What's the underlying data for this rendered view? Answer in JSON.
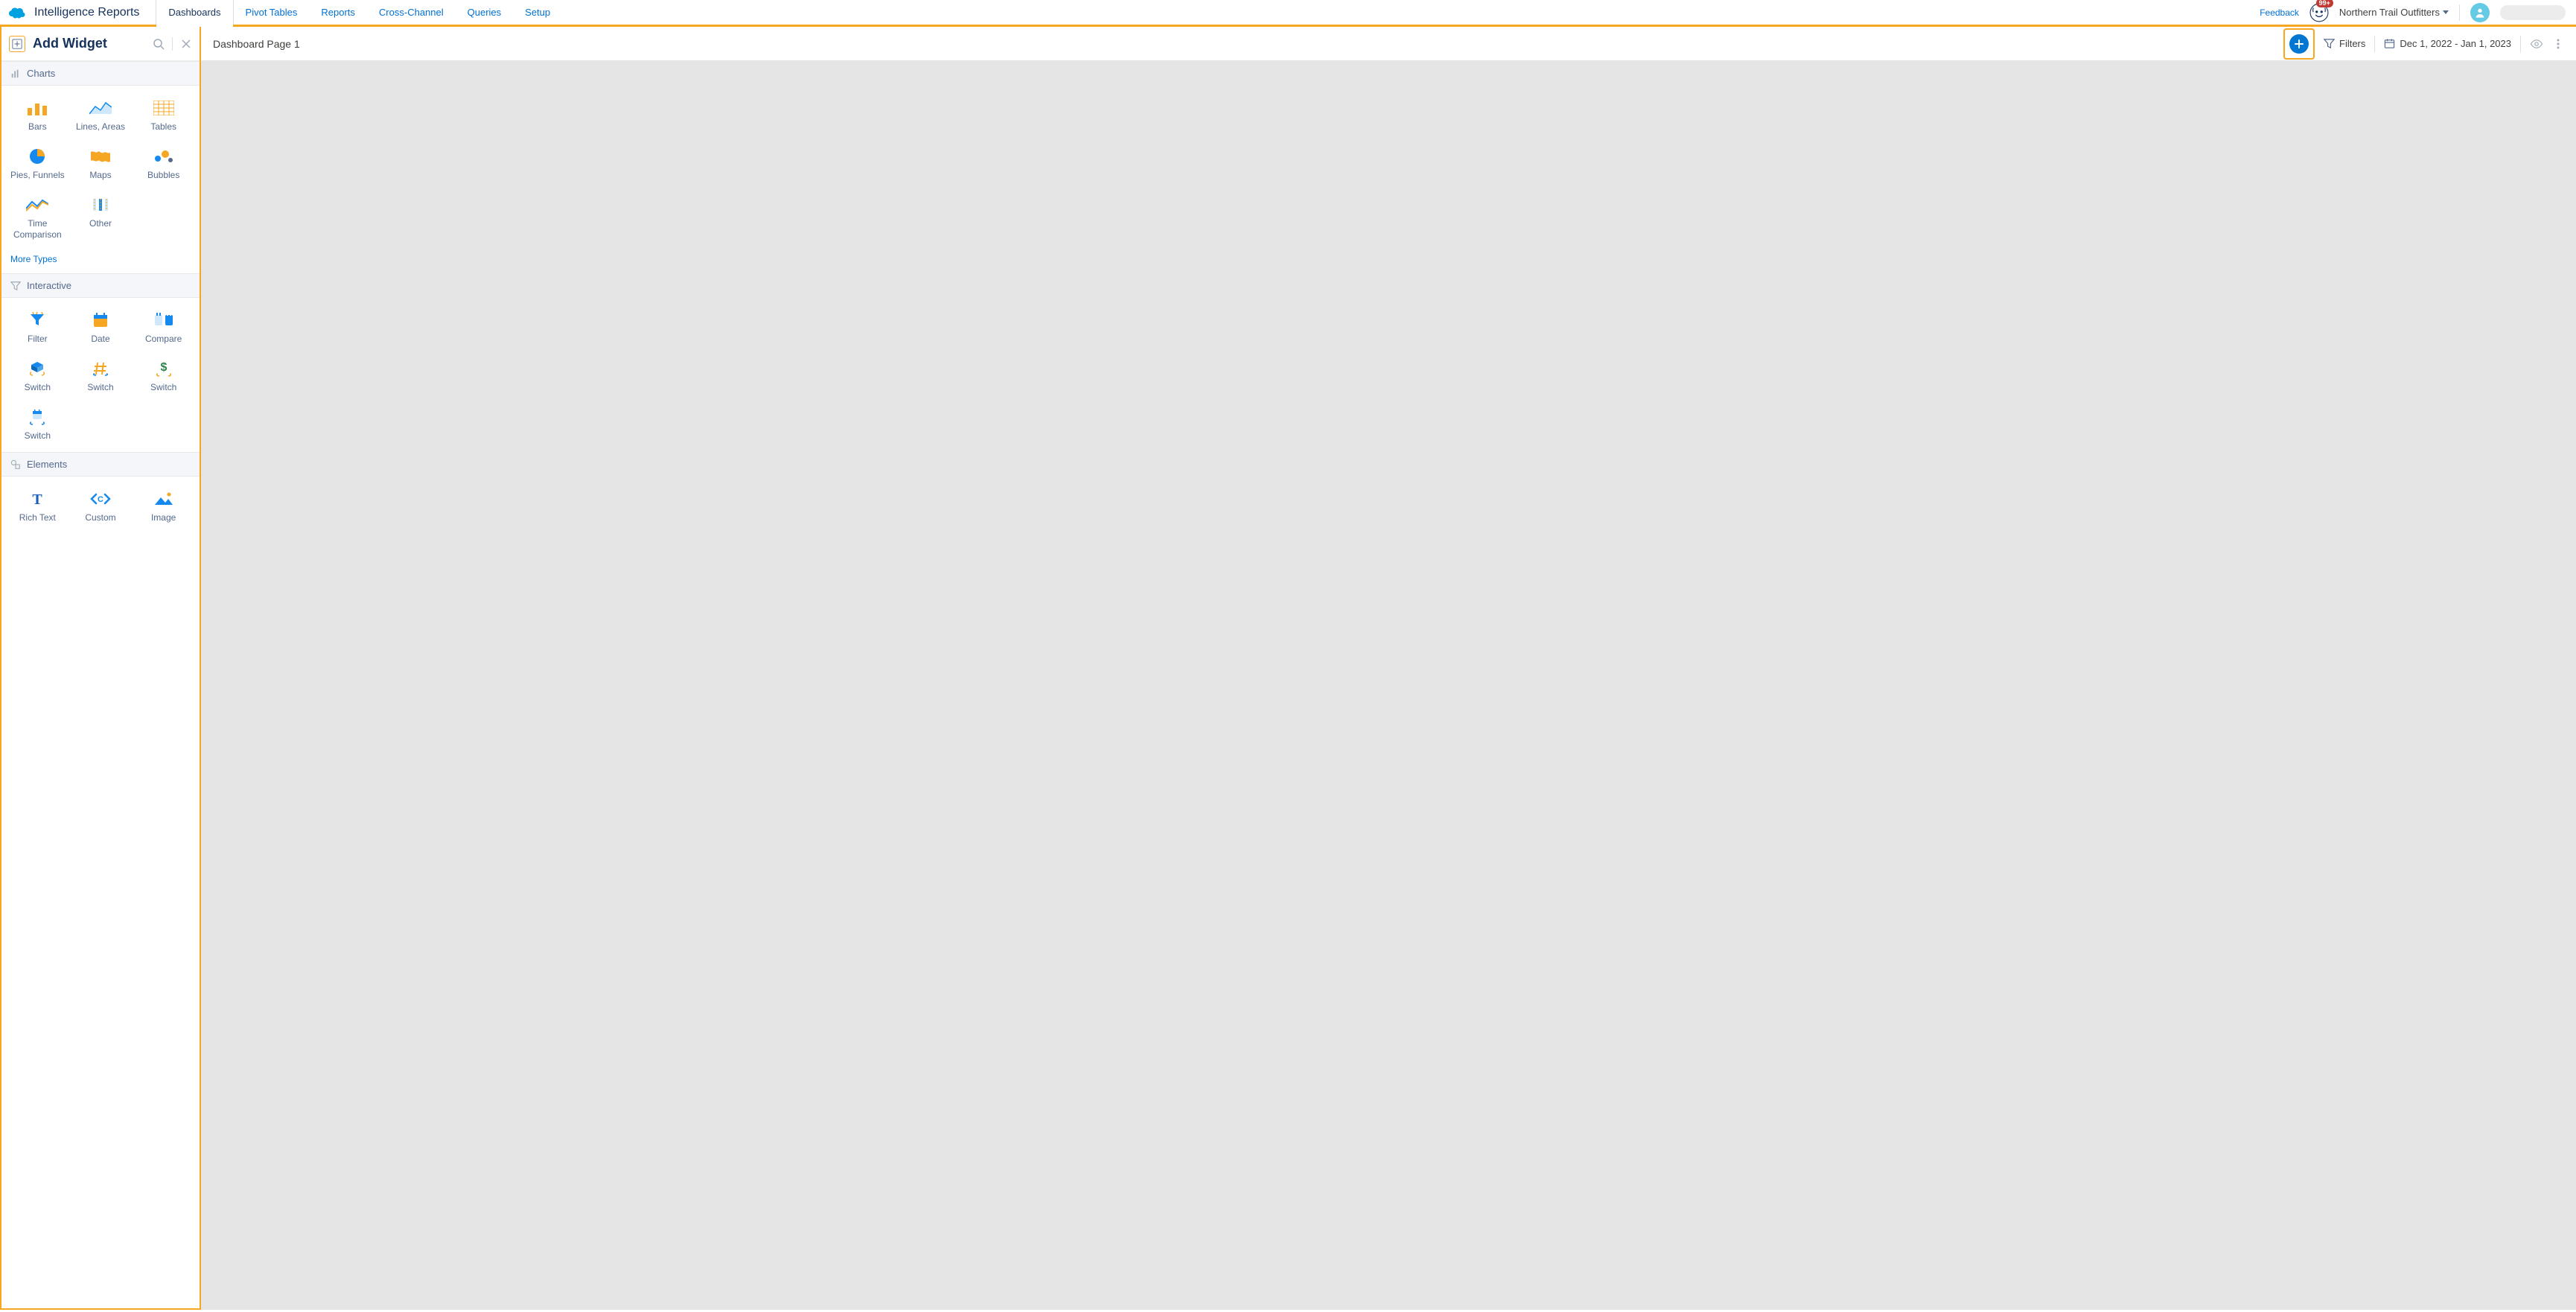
{
  "header": {
    "app_title": "Intelligence Reports",
    "tabs": [
      "Dashboards",
      "Pivot Tables",
      "Reports",
      "Cross-Channel",
      "Queries",
      "Setup"
    ],
    "active_tab": "Dashboards",
    "feedback": "Feedback",
    "badge": "99+",
    "org": "Northern Trail Outfitters"
  },
  "sidebar": {
    "title": "Add Widget",
    "sections": {
      "charts": {
        "title": "Charts",
        "items": [
          "Bars",
          "Lines, Areas",
          "Tables",
          "Pies, Funnels",
          "Maps",
          "Bubbles",
          "Time Comparison",
          "Other"
        ],
        "more": "More Types"
      },
      "interactive": {
        "title": "Interactive",
        "items": [
          "Filter",
          "Date",
          "Compare",
          "Switch",
          "Switch",
          "Switch",
          "Switch"
        ]
      },
      "elements": {
        "title": "Elements",
        "items": [
          "Rich Text",
          "Custom",
          "Image"
        ]
      }
    }
  },
  "toolbar": {
    "page_title": "Dashboard Page 1",
    "filters": "Filters",
    "date_range": "Dec 1, 2022 - Jan 1, 2023"
  }
}
